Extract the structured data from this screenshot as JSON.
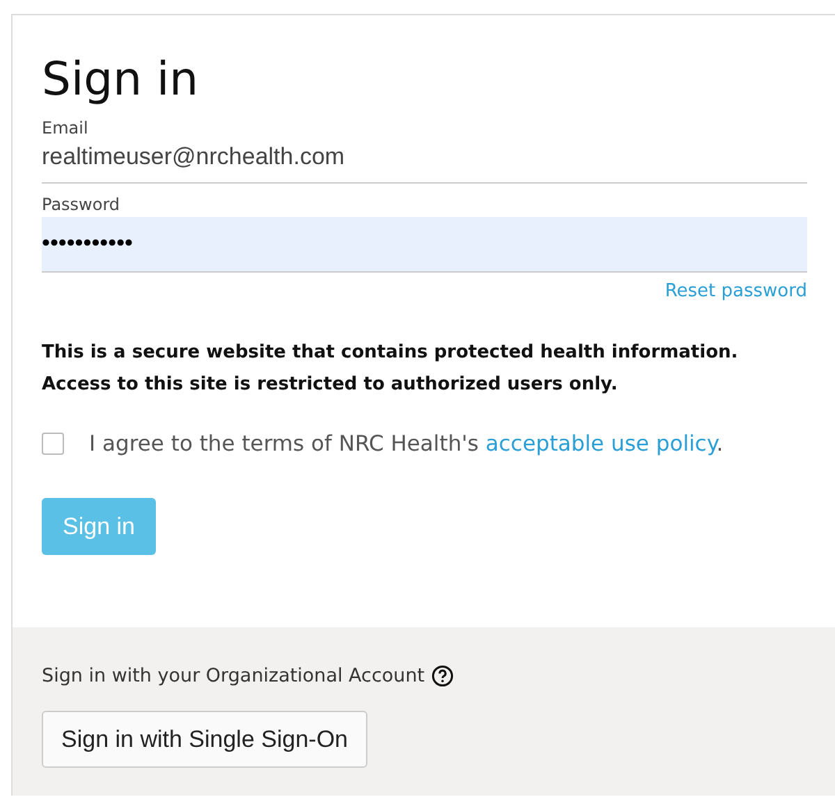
{
  "title": "Sign in",
  "email": {
    "label": "Email",
    "value": "realtimeuser@nrchealth.com"
  },
  "password": {
    "label": "Password",
    "value": "•••••••••••",
    "autofilled": true
  },
  "reset_link": "Reset password",
  "notice": "This is a secure website that contains protected health information. Access to this site is restricted to authorized users only.",
  "agreement": {
    "checked": false,
    "text": "I agree to the terms of NRC Health's ",
    "link": "acceptable use policy",
    "end": "."
  },
  "sign_in_button": {
    "label": "Sign in",
    "disabled": true
  },
  "organizational": {
    "text": "Sign in with your Organizational Account",
    "button": "Sign in with Single Sign-On"
  }
}
